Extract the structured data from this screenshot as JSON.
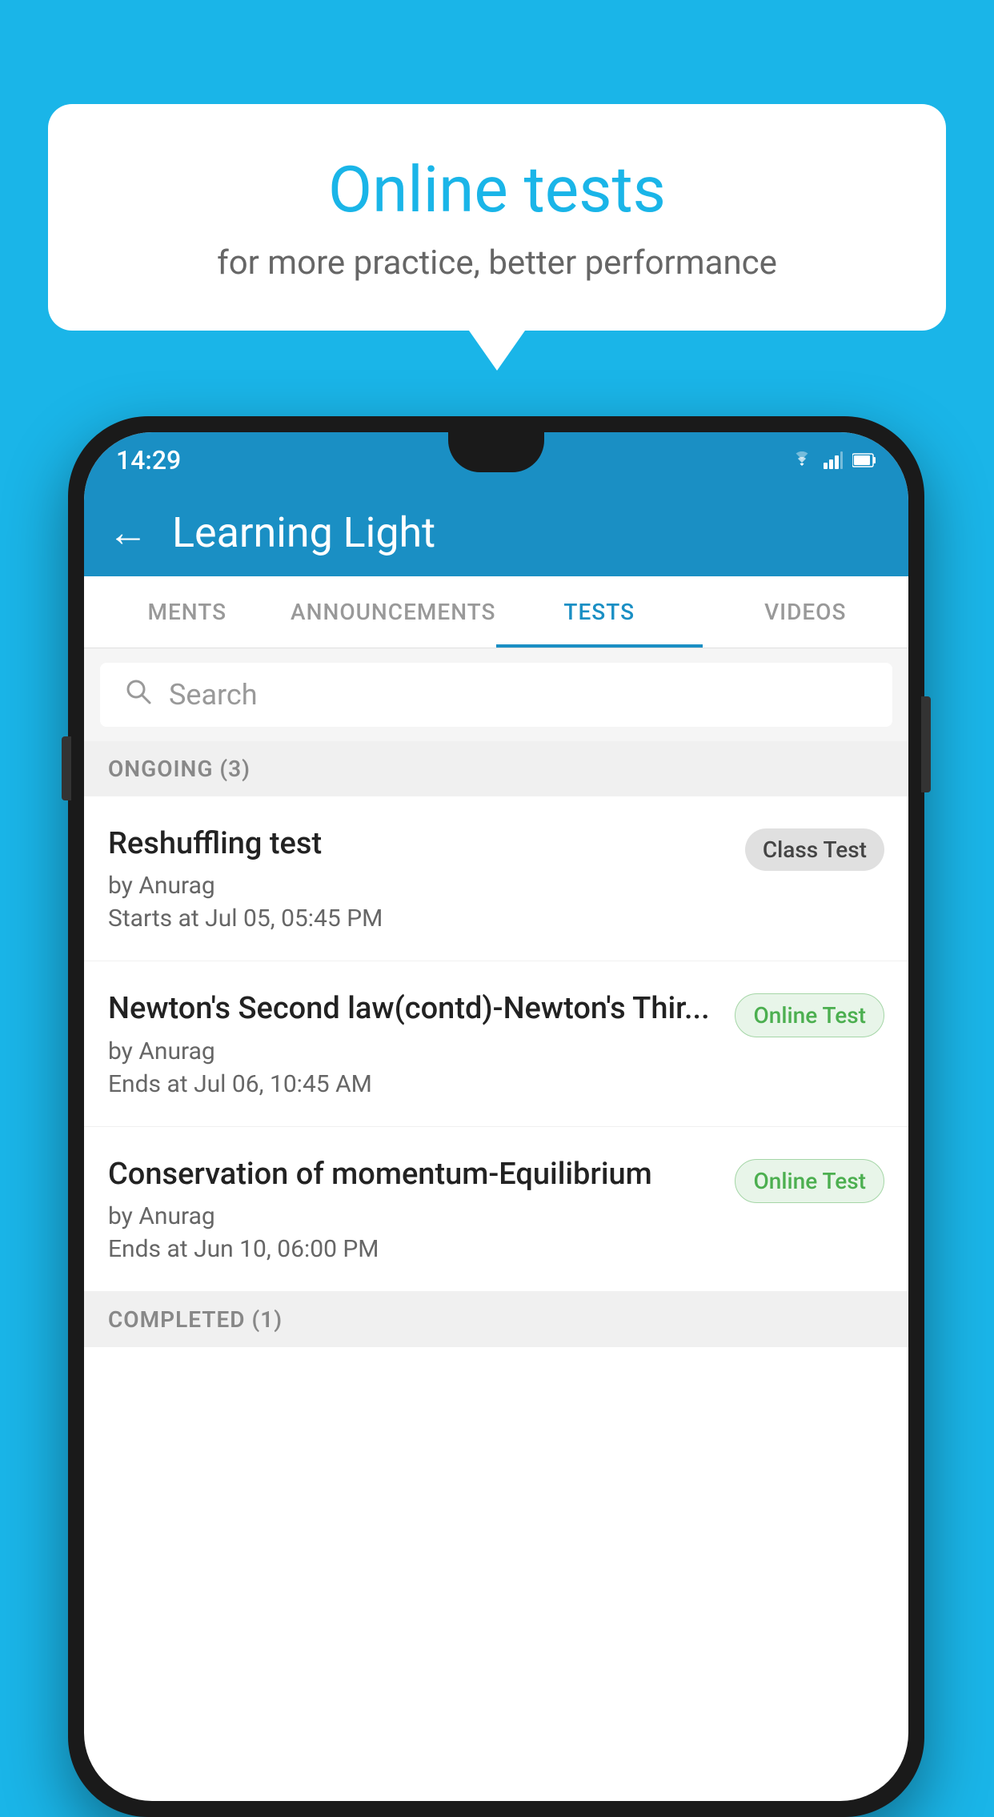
{
  "background_color": "#1ab5e8",
  "speech_bubble": {
    "title": "Online tests",
    "subtitle": "for more practice, better performance"
  },
  "phone": {
    "status_bar": {
      "time": "14:29"
    },
    "app_bar": {
      "title": "Learning Light"
    },
    "tabs": [
      {
        "label": "MENTS",
        "active": false
      },
      {
        "label": "ANNOUNCEMENTS",
        "active": false
      },
      {
        "label": "TESTS",
        "active": true
      },
      {
        "label": "VIDEOS",
        "active": false
      }
    ],
    "search": {
      "placeholder": "Search"
    },
    "section": {
      "title": "ONGOING (3)"
    },
    "tests": [
      {
        "name": "Reshuffling test",
        "author": "by Anurag",
        "time_label": "Starts at",
        "time": "Jul 05, 05:45 PM",
        "badge": "Class Test",
        "badge_type": "gray"
      },
      {
        "name": "Newton's Second law(contd)-Newton's Thir...",
        "author": "by Anurag",
        "time_label": "Ends at",
        "time": "Jul 06, 10:45 AM",
        "badge": "Online Test",
        "badge_type": "green"
      },
      {
        "name": "Conservation of momentum-Equilibrium",
        "author": "by Anurag",
        "time_label": "Ends at",
        "time": "Jun 10, 06:00 PM",
        "badge": "Online Test",
        "badge_type": "green"
      }
    ],
    "completed_section": {
      "title": "COMPLETED (1)"
    }
  }
}
